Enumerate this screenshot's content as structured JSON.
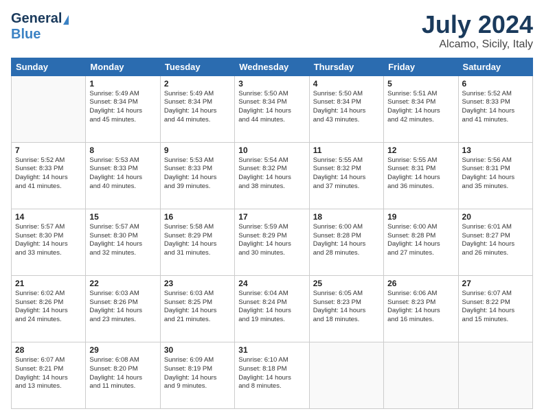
{
  "header": {
    "logo_general": "General",
    "logo_blue": "Blue",
    "main_title": "July 2024",
    "subtitle": "Alcamo, Sicily, Italy"
  },
  "calendar": {
    "days_of_week": [
      "Sunday",
      "Monday",
      "Tuesday",
      "Wednesday",
      "Thursday",
      "Friday",
      "Saturday"
    ],
    "weeks": [
      [
        {
          "day": "",
          "info": ""
        },
        {
          "day": "1",
          "info": "Sunrise: 5:49 AM\nSunset: 8:34 PM\nDaylight: 14 hours\nand 45 minutes."
        },
        {
          "day": "2",
          "info": "Sunrise: 5:49 AM\nSunset: 8:34 PM\nDaylight: 14 hours\nand 44 minutes."
        },
        {
          "day": "3",
          "info": "Sunrise: 5:50 AM\nSunset: 8:34 PM\nDaylight: 14 hours\nand 44 minutes."
        },
        {
          "day": "4",
          "info": "Sunrise: 5:50 AM\nSunset: 8:34 PM\nDaylight: 14 hours\nand 43 minutes."
        },
        {
          "day": "5",
          "info": "Sunrise: 5:51 AM\nSunset: 8:34 PM\nDaylight: 14 hours\nand 42 minutes."
        },
        {
          "day": "6",
          "info": "Sunrise: 5:52 AM\nSunset: 8:33 PM\nDaylight: 14 hours\nand 41 minutes."
        }
      ],
      [
        {
          "day": "7",
          "info": "Sunrise: 5:52 AM\nSunset: 8:33 PM\nDaylight: 14 hours\nand 41 minutes."
        },
        {
          "day": "8",
          "info": "Sunrise: 5:53 AM\nSunset: 8:33 PM\nDaylight: 14 hours\nand 40 minutes."
        },
        {
          "day": "9",
          "info": "Sunrise: 5:53 AM\nSunset: 8:33 PM\nDaylight: 14 hours\nand 39 minutes."
        },
        {
          "day": "10",
          "info": "Sunrise: 5:54 AM\nSunset: 8:32 PM\nDaylight: 14 hours\nand 38 minutes."
        },
        {
          "day": "11",
          "info": "Sunrise: 5:55 AM\nSunset: 8:32 PM\nDaylight: 14 hours\nand 37 minutes."
        },
        {
          "day": "12",
          "info": "Sunrise: 5:55 AM\nSunset: 8:31 PM\nDaylight: 14 hours\nand 36 minutes."
        },
        {
          "day": "13",
          "info": "Sunrise: 5:56 AM\nSunset: 8:31 PM\nDaylight: 14 hours\nand 35 minutes."
        }
      ],
      [
        {
          "day": "14",
          "info": "Sunrise: 5:57 AM\nSunset: 8:30 PM\nDaylight: 14 hours\nand 33 minutes."
        },
        {
          "day": "15",
          "info": "Sunrise: 5:57 AM\nSunset: 8:30 PM\nDaylight: 14 hours\nand 32 minutes."
        },
        {
          "day": "16",
          "info": "Sunrise: 5:58 AM\nSunset: 8:29 PM\nDaylight: 14 hours\nand 31 minutes."
        },
        {
          "day": "17",
          "info": "Sunrise: 5:59 AM\nSunset: 8:29 PM\nDaylight: 14 hours\nand 30 minutes."
        },
        {
          "day": "18",
          "info": "Sunrise: 6:00 AM\nSunset: 8:28 PM\nDaylight: 14 hours\nand 28 minutes."
        },
        {
          "day": "19",
          "info": "Sunrise: 6:00 AM\nSunset: 8:28 PM\nDaylight: 14 hours\nand 27 minutes."
        },
        {
          "day": "20",
          "info": "Sunrise: 6:01 AM\nSunset: 8:27 PM\nDaylight: 14 hours\nand 26 minutes."
        }
      ],
      [
        {
          "day": "21",
          "info": "Sunrise: 6:02 AM\nSunset: 8:26 PM\nDaylight: 14 hours\nand 24 minutes."
        },
        {
          "day": "22",
          "info": "Sunrise: 6:03 AM\nSunset: 8:26 PM\nDaylight: 14 hours\nand 23 minutes."
        },
        {
          "day": "23",
          "info": "Sunrise: 6:03 AM\nSunset: 8:25 PM\nDaylight: 14 hours\nand 21 minutes."
        },
        {
          "day": "24",
          "info": "Sunrise: 6:04 AM\nSunset: 8:24 PM\nDaylight: 14 hours\nand 19 minutes."
        },
        {
          "day": "25",
          "info": "Sunrise: 6:05 AM\nSunset: 8:23 PM\nDaylight: 14 hours\nand 18 minutes."
        },
        {
          "day": "26",
          "info": "Sunrise: 6:06 AM\nSunset: 8:23 PM\nDaylight: 14 hours\nand 16 minutes."
        },
        {
          "day": "27",
          "info": "Sunrise: 6:07 AM\nSunset: 8:22 PM\nDaylight: 14 hours\nand 15 minutes."
        }
      ],
      [
        {
          "day": "28",
          "info": "Sunrise: 6:07 AM\nSunset: 8:21 PM\nDaylight: 14 hours\nand 13 minutes."
        },
        {
          "day": "29",
          "info": "Sunrise: 6:08 AM\nSunset: 8:20 PM\nDaylight: 14 hours\nand 11 minutes."
        },
        {
          "day": "30",
          "info": "Sunrise: 6:09 AM\nSunset: 8:19 PM\nDaylight: 14 hours\nand 9 minutes."
        },
        {
          "day": "31",
          "info": "Sunrise: 6:10 AM\nSunset: 8:18 PM\nDaylight: 14 hours\nand 8 minutes."
        },
        {
          "day": "",
          "info": ""
        },
        {
          "day": "",
          "info": ""
        },
        {
          "day": "",
          "info": ""
        }
      ]
    ]
  }
}
